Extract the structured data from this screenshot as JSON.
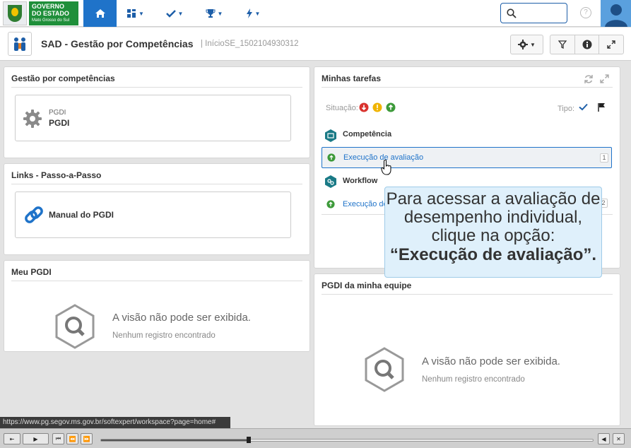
{
  "topbar": {
    "logo": {
      "line1": "GOVERNO",
      "line2": "DO ESTADO",
      "line3": "Mato Grosso do Sul"
    },
    "nav": [
      "home-icon",
      "dashboard-icon",
      "check-icon",
      "trophy-icon",
      "bolt-icon"
    ],
    "help_label": "?"
  },
  "header": {
    "title": "SAD - Gestão por Competências",
    "subtitle": "| InícioSE_1502104930312"
  },
  "panels": {
    "gestao": {
      "title": "Gestão por competências",
      "card_label_small": "PGDI",
      "card_label": "PGDI"
    },
    "links": {
      "title": "Links - Passo-a-Passo",
      "card_label": "Manual do PGDI"
    },
    "meu": {
      "title": "Meu PGDI",
      "empty_title": "A visão não pode ser exibida.",
      "empty_sub": "Nenhum registro encontrado"
    },
    "tarefas": {
      "title": "Minhas tarefas",
      "situacao_label": "Situação:",
      "tipo_label": "Tipo:",
      "groups": [
        {
          "label": "Competência",
          "items": [
            {
              "label": "Execução de avaliação",
              "count": "1"
            }
          ]
        },
        {
          "label": "Workflow",
          "items": [
            {
              "label": "Execução de",
              "count": "2"
            }
          ]
        }
      ]
    },
    "equipe": {
      "title": "PGDI da minha equipe",
      "empty_title": "A visão não pode ser exibida.",
      "empty_sub": "Nenhum registro encontrado"
    }
  },
  "callout": {
    "line1": "Para acessar a avaliação de",
    "line2": "desempenho individual,",
    "line3": "clique na opção:",
    "line4": "“Execução de avaliação”."
  },
  "status_url": "https://www.pg.segov.ms.gov.br/softexpert/workspace?page=home#",
  "player": {
    "progress": 0.3
  },
  "colors": {
    "accent": "#1f73c9",
    "red": "#d9322e",
    "yellow": "#f0b400",
    "green": "#3d9a3a",
    "teal": "#1a7a86"
  }
}
